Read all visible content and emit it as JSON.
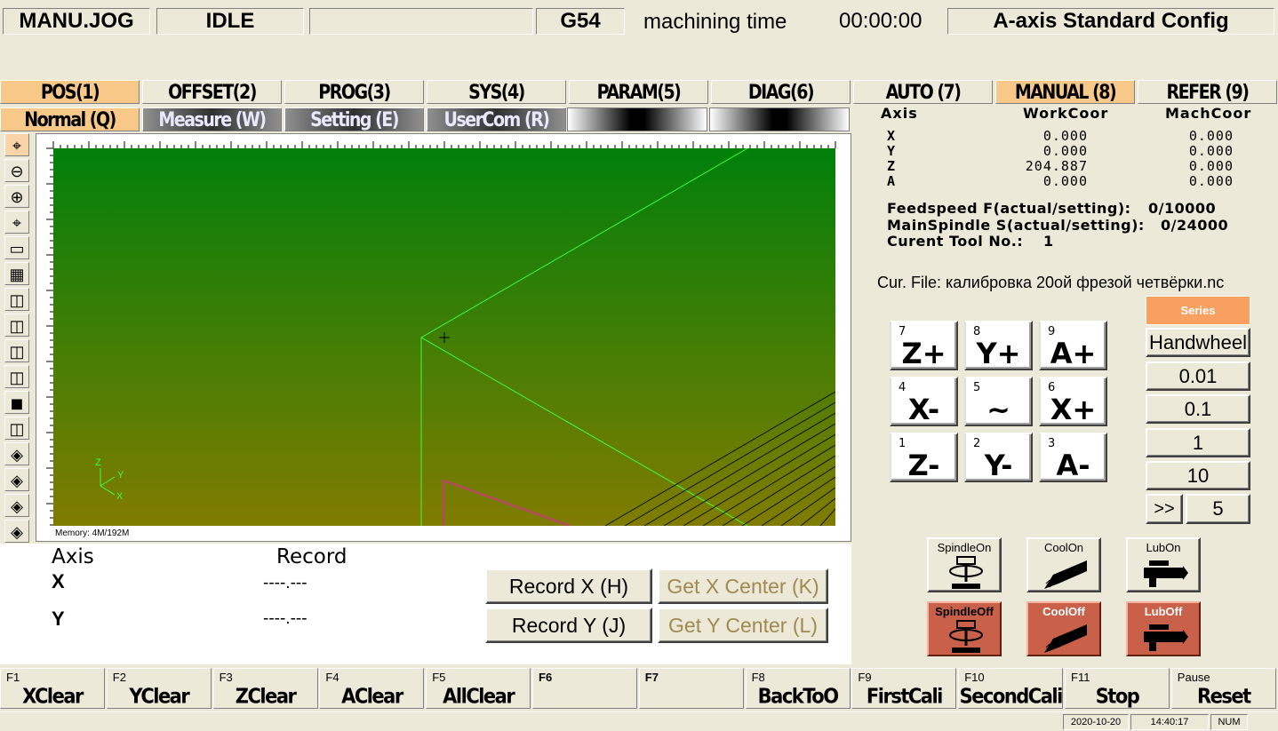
{
  "status": {
    "mode": "MANU.JOG",
    "state": "IDLE",
    "message": "",
    "coord": "G54",
    "time_label": "machining time",
    "time_value": "00:00:00",
    "config": "A-axis Standard Config"
  },
  "tabs": [
    "POS(1)",
    "OFFSET(2)",
    "PROG(3)",
    "SYS(4)",
    "PARAM(5)",
    "DIAG(6)",
    "AUTO (7)",
    "MANUAL (8)",
    "REFER (9)"
  ],
  "subtabs": [
    "Normal (Q)",
    "Measure (W)",
    "Setting (E)",
    "UserCom (R)"
  ],
  "view": {
    "memory": "Memory: 4M/192M",
    "triad_z": "Z",
    "triad_y": "Y",
    "triad_x": "X"
  },
  "tool_icons": [
    "crosshair-icon",
    "zoom-out-icon",
    "zoom-in-icon",
    "pan-icon",
    "fit-window-icon",
    "grid-icon",
    "view-cube-xy-icon",
    "view-cube-xz-icon",
    "view-cube-yz-icon",
    "view-cube-iso1-icon",
    "view-cube-iso2-icon",
    "view-cube-iso3-icon",
    "view-cube-iso4-icon",
    "view-cube-iso5-icon",
    "view-cube-iso6-icon",
    "view-cube-iso7-icon"
  ],
  "record": {
    "axis_header": "Axis",
    "record_header": "Record",
    "x_label": "X",
    "x_value": "----.---",
    "y_label": "Y",
    "y_value": "----.---",
    "record_x": "Record X (H)",
    "record_y": "Record Y (J)",
    "get_x_center": "Get X Center (K)",
    "get_y_center": "Get Y Center (L)"
  },
  "coords": {
    "axis_header": "Axis",
    "work_header": "WorkCoor",
    "mach_header": "MachCoor",
    "rows": [
      {
        "axis": "X",
        "work": "0.000",
        "mach": "0.000"
      },
      {
        "axis": "Y",
        "work": "0.000",
        "mach": "0.000"
      },
      {
        "axis": "Z",
        "work": "204.887",
        "mach": "0.000"
      },
      {
        "axis": "A",
        "work": "0.000",
        "mach": "0.000"
      }
    ]
  },
  "info": {
    "feed_label": "Feedspeed F(actual/setting):",
    "feed_value": "0/10000",
    "spindle_label": "MainSpindle S(actual/setting):",
    "spindle_value": "0/24000",
    "tool_label": "Curent Tool No.:",
    "tool_value": "1",
    "file": "Cur. File: калибровка 20ой фрезой четвёрки.nc"
  },
  "jog": [
    {
      "num": "7",
      "label": "Z+"
    },
    {
      "num": "8",
      "label": "Y+"
    },
    {
      "num": "9",
      "label": "A+"
    },
    {
      "num": "4",
      "label": "X-"
    },
    {
      "num": "5",
      "label": "~"
    },
    {
      "num": "6",
      "label": "X+"
    },
    {
      "num": "1",
      "label": "Z-"
    },
    {
      "num": "2",
      "label": "Y-"
    },
    {
      "num": "3",
      "label": "A-"
    }
  ],
  "rates": {
    "series": "Series",
    "handwheel": "Handwheel",
    "r1": "0.01",
    "r2": "0.1",
    "r3": "1",
    "r4": "10",
    "more": ">>",
    "custom": "5"
  },
  "peripherals": {
    "spindle_on": "SpindleOn",
    "cool_on": "CoolOn",
    "lub_on": "LubOn",
    "spindle_off": "SpindleOff",
    "cool_off": "CoolOff",
    "lub_off": "LubOff"
  },
  "fkeys": [
    {
      "key": "F1",
      "label": "XClear"
    },
    {
      "key": "F2",
      "label": "YClear"
    },
    {
      "key": "F3",
      "label": "ZClear"
    },
    {
      "key": "F4",
      "label": "AClear"
    },
    {
      "key": "F5",
      "label": "AllClear"
    },
    {
      "key": "F6",
      "label": ""
    },
    {
      "key": "F7",
      "label": ""
    },
    {
      "key": "F8",
      "label": "BackToO"
    },
    {
      "key": "F9",
      "label": "FirstCali"
    },
    {
      "key": "F10",
      "label": "SecondCali"
    },
    {
      "key": "F11",
      "label": "Stop"
    },
    {
      "key": "Pause",
      "label": "Reset"
    }
  ],
  "taskbar": {
    "date": "2020-10-20",
    "time": "14:40:17",
    "num": "NUM"
  },
  "colors": {
    "active_tab": "#f8c888",
    "view_top": "#00800a",
    "view_bottom": "#807c00",
    "off_button": "#c8604a"
  }
}
